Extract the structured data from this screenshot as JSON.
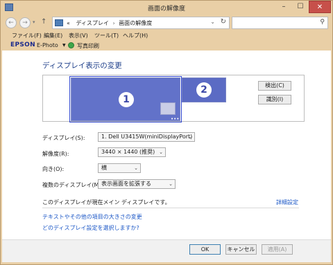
{
  "window": {
    "title": "画面の解像度"
  },
  "address": {
    "prefix": "«",
    "crumbs": [
      "ディスプレイ",
      "画面の解像度"
    ],
    "search_placeholder": ""
  },
  "menu": {
    "items": [
      "ファイル(F)",
      "編集(E)",
      "表示(V)",
      "ツール(T)",
      "ヘルプ(H)"
    ]
  },
  "epson": {
    "logo": "EPSON",
    "ephoto": "E-Photo",
    "print_label": "写真印刷"
  },
  "main": {
    "heading": "ディスプレイ表示の変更",
    "monitor1_badge": "1",
    "monitor2_badge": "2",
    "detect_label": "検出(C)",
    "identify_label": "識別(I)",
    "display_label": "ディスプレイ(S):",
    "display_value": "1. Dell U3415W(miniDisplayPort)",
    "resolution_label": "解像度(R):",
    "resolution_value": "3440 × 1440 (推奨)",
    "orientation_label": "向き(O):",
    "orientation_value": "横",
    "multi_label": "複数のディスプレイ(M):",
    "multi_value": "表示画面を拡張する",
    "info_text": "このディスプレイが現在メイン ディスプレイです。",
    "advanced_link": "詳細設定",
    "link_text_size": "テキストやその他の項目の大きさの変更",
    "link_which": "どのディスプレイ設定を選択しますか?"
  },
  "footer": {
    "ok": "OK",
    "cancel": "キャンセル",
    "apply": "適用(A)"
  }
}
